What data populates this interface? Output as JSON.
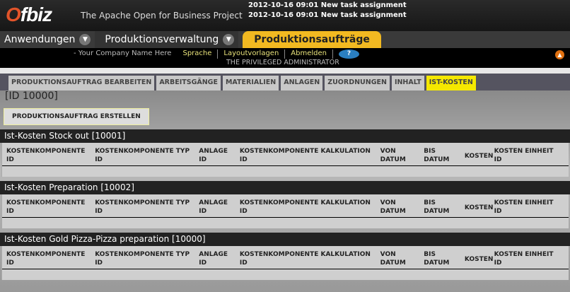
{
  "header": {
    "logo": "Ofbiz",
    "tagline": "The Apache Open for Business Project",
    "notifications": [
      "2012-10-16 09:01 New task assignment",
      "2012-10-16 09:01 New task assignment"
    ]
  },
  "nav": {
    "apps": "Anwendungen",
    "module": "Produktionsverwaltung",
    "active": "Produktionsaufträge"
  },
  "userbar": {
    "company": "- Your Company Name Here",
    "links": [
      "Sprache",
      "Layoutvorlagen",
      "Abmelden"
    ],
    "user": "THE PRIVILEGED ADMINISTRATOR",
    "help": "?"
  },
  "tabs": [
    "PRODUKTIONSAUFTRAG BEARBEITEN",
    "ARBEITSGÄNGE",
    "MATERIALIEN",
    "ANLAGEN",
    "ZUORDNUNGEN",
    "INHALT",
    "IST-KOSTEN"
  ],
  "id_label": "[ID 10000]",
  "create_button": "PRODUKTIONSAUFTRAG ERSTELLEN",
  "columns": [
    [
      "KOSTENKOMPONENTE",
      "ID"
    ],
    [
      "KOSTENKOMPONENTE TYP",
      "ID"
    ],
    [
      "ANLAGE",
      "ID"
    ],
    [
      "KOSTENKOMPONENTE KALKULATION",
      "ID"
    ],
    [
      "VON",
      "DATUM"
    ],
    [
      "BIS",
      "DATUM"
    ],
    [
      "KOSTEN",
      ""
    ],
    [
      "KOSTEN EINHEIT",
      "ID"
    ]
  ],
  "sections": [
    {
      "title": "Ist-Kosten Stock out",
      "id": "[10001]"
    },
    {
      "title": "Ist-Kosten Preparation",
      "id": "[10002]"
    },
    {
      "title": "Ist-Kosten Gold Pizza-Pizza preparation",
      "id": "[10000]"
    }
  ]
}
